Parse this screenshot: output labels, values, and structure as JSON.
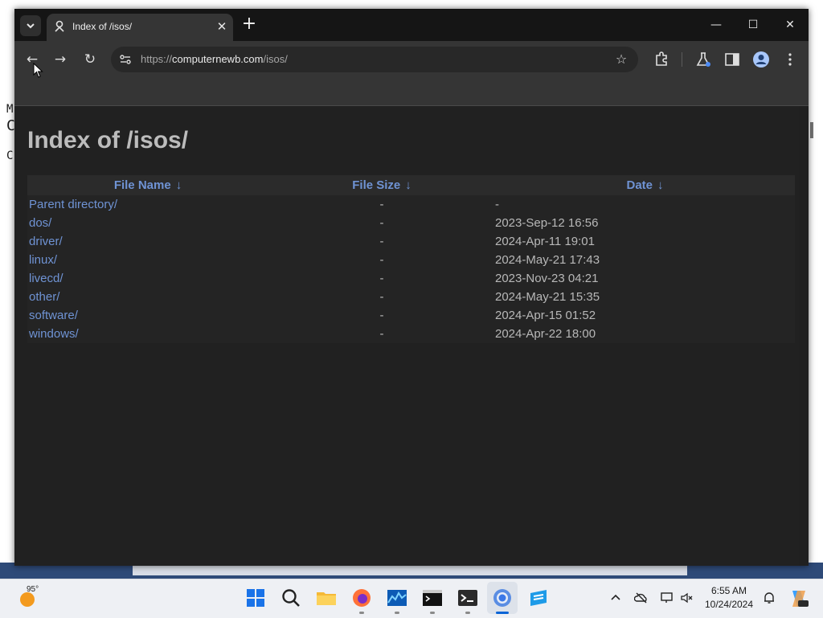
{
  "background": {
    "terminal_lines": [
      "M",
      "C",
      "C"
    ]
  },
  "browser": {
    "tab": {
      "title": "Index of /isos/",
      "close_icon": "close-icon"
    },
    "tab_search_icon": "chevron-down-icon",
    "new_tab_icon": "plus-icon",
    "window_controls": {
      "minimize": "—",
      "maximize": "☐",
      "close": "✕"
    },
    "toolbar": {
      "back": "←",
      "forward": "→",
      "reload": "↻",
      "url_scheme": "https://",
      "url_host": "computernewb.com",
      "url_path": "/isos/",
      "bookmark_icon": "star-icon"
    }
  },
  "page": {
    "title": "Index of /isos/",
    "columns": [
      {
        "label": "File Name",
        "arrow": "↓"
      },
      {
        "label": "File Size",
        "arrow": "↓"
      },
      {
        "label": "Date",
        "arrow": "↓"
      }
    ],
    "rows": [
      {
        "name": "Parent directory/",
        "size": "-",
        "date": "-"
      },
      {
        "name": "dos/",
        "size": "-",
        "date": "2023-Sep-12 16:56"
      },
      {
        "name": "driver/",
        "size": "-",
        "date": "2024-Apr-11 19:01"
      },
      {
        "name": "linux/",
        "size": "-",
        "date": "2024-May-21 17:43"
      },
      {
        "name": "livecd/",
        "size": "-",
        "date": "2023-Nov-23 04:21"
      },
      {
        "name": "other/",
        "size": "-",
        "date": "2024-May-21 15:35"
      },
      {
        "name": "software/",
        "size": "-",
        "date": "2024-Apr-15 01:52"
      },
      {
        "name": "windows/",
        "size": "-",
        "date": "2024-Apr-22 18:00"
      }
    ]
  },
  "taskbar": {
    "weather_temp": "95°",
    "clock_time": "6:55 AM",
    "clock_date": "10/24/2024",
    "apps": [
      "start-icon",
      "search-icon",
      "file-explorer-icon",
      "firefox-icon",
      "task-manager-icon",
      "terminal-icon",
      "terminal-icon",
      "chrome-icon",
      "app-icon"
    ]
  },
  "colors": {
    "link": "#6f93d4",
    "text": "#b8b8b8",
    "title": "#bcbcbc",
    "page_bg": "#212121",
    "accent": "#0a64d6"
  }
}
